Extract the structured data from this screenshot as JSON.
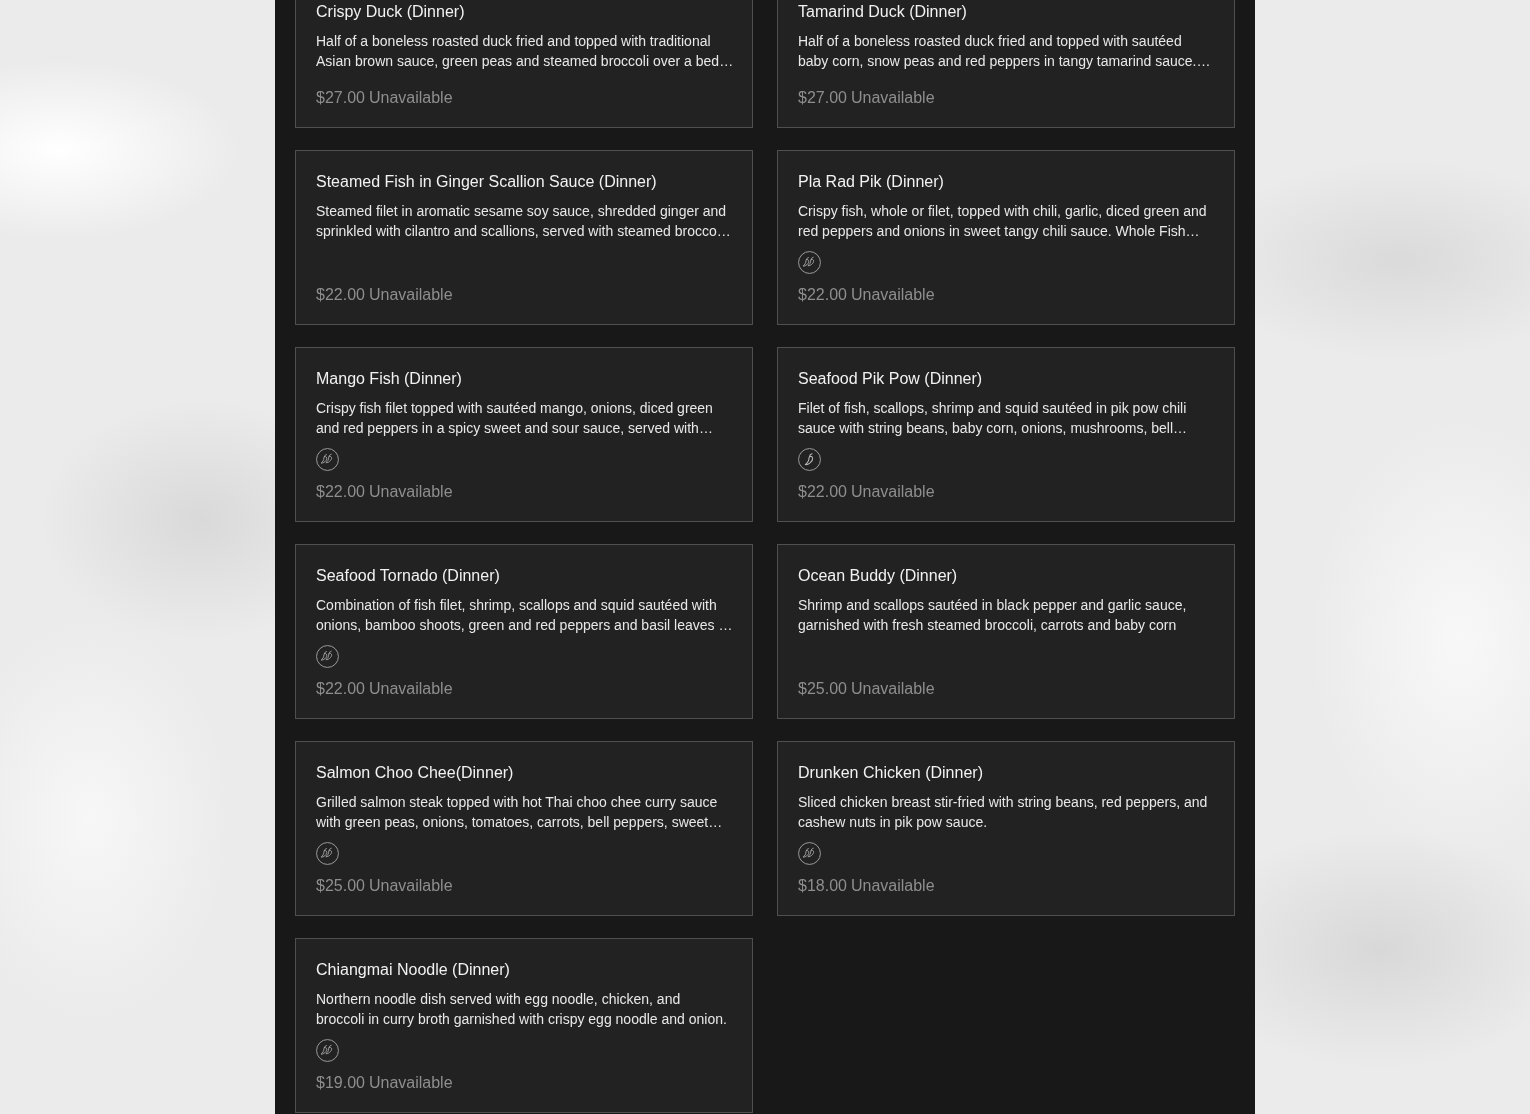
{
  "menu_items": [
    {
      "name": "Crispy Duck (Dinner)",
      "description": [
        "Half of a boneless roasted duck fried and topped with traditional",
        "Asian brown sauce, green peas and steamed broccoli over a bed…"
      ],
      "price": "$27.00",
      "availability": "Unavailable"
    },
    {
      "name": "Tamarind Duck (Dinner)",
      "description": [
        "Half of a boneless roasted duck fried and topped with sautéed",
        "baby corn, snow peas and red peppers in tangy tamarind sauce.…"
      ],
      "price": "$27.00",
      "availability": "Unavailable"
    },
    {
      "name": "Steamed Fish in Ginger Scallion Sauce (Dinner)",
      "description": [
        "Steamed filet in aromatic sesame soy sauce, shredded ginger and",
        "sprinkled with cilantro and scallions, served with steamed brocco…"
      ],
      "price": "$22.00",
      "availability": "Unavailable"
    },
    {
      "name": "Pla Rad Pik (Dinner)",
      "description": [
        "Crispy fish, whole or filet, topped with chili, garlic, diced green and",
        "red peppers and onions in sweet tangy chili sauce. Whole Fish…"
      ],
      "labels": [
        {
          "kind": "spicy2"
        }
      ],
      "price": "$22.00",
      "availability": "Unavailable"
    },
    {
      "name": "Mango Fish (Dinner)",
      "description": [
        "Crispy fish filet topped with sautéed mango, onions, diced green",
        "and red peppers in a spicy sweet and sour sauce, served with…"
      ],
      "labels": [
        {
          "kind": "spicy2"
        }
      ],
      "price": "$22.00",
      "availability": "Unavailable"
    },
    {
      "name": "Seafood Pik Pow (Dinner)",
      "description": [
        "Filet of fish, scallops, shrimp and squid sautéed in pik pow chili",
        "sauce with string beans, baby corn, onions, mushrooms, bell…"
      ],
      "labels": [
        {
          "kind": "spicy1"
        }
      ],
      "price": "$22.00",
      "availability": "Unavailable"
    },
    {
      "name": "Seafood Tornado (Dinner)",
      "description": [
        "Combination of fish filet, shrimp, scallops and squid sautéed with",
        "onions, bamboo shoots, green and red peppers and basil leaves …"
      ],
      "labels": [
        {
          "kind": "spicy2"
        }
      ],
      "price": "$22.00",
      "availability": "Unavailable"
    },
    {
      "name": "Ocean Buddy (Dinner)",
      "description": [
        "Shrimp and scallops sautéed in black pepper and garlic sauce,",
        "garnished with fresh steamed broccoli, carrots and baby corn"
      ],
      "price": "$25.00",
      "availability": "Unavailable"
    },
    {
      "name": "Salmon Choo Chee(Dinner)",
      "description": [
        "Grilled salmon steak topped with hot Thai choo chee curry sauce",
        "with green peas, onions, tomatoes, carrots, bell peppers, sweet…"
      ],
      "labels": [
        {
          "kind": "spicy2"
        }
      ],
      "price": "$25.00",
      "availability": "Unavailable"
    },
    {
      "name": "Drunken Chicken (Dinner)",
      "description": [
        "Sliced chicken breast stir-fried with string beans, red peppers, and",
        "cashew nuts in pik pow sauce."
      ],
      "labels": [
        {
          "kind": "spicy2"
        }
      ],
      "price": "$18.00",
      "availability": "Unavailable"
    },
    {
      "name": "Chiangmai Noodle (Dinner)",
      "description": [
        "Northern noodle dish served with egg noodle, chicken, and",
        "broccoli in curry broth garnished with crispy egg noodle and onion."
      ],
      "labels": [
        {
          "kind": "spicy2"
        }
      ],
      "price": "$19.00",
      "availability": "Unavailable"
    }
  ]
}
